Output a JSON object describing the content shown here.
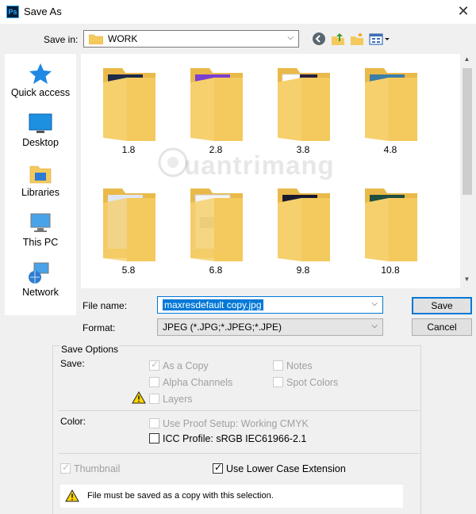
{
  "window": {
    "title": "Save As",
    "app_icon": "Ps",
    "close": "✕"
  },
  "savein": {
    "label": "Save in:",
    "value": "WORK"
  },
  "places": [
    {
      "label": "Quick access",
      "icon": "star-icon"
    },
    {
      "label": "Desktop",
      "icon": "desktop-icon"
    },
    {
      "label": "Libraries",
      "icon": "libraries-icon"
    },
    {
      "label": "This PC",
      "icon": "computer-icon"
    },
    {
      "label": "Network",
      "icon": "network-icon"
    }
  ],
  "files": [
    {
      "name": "1.8"
    },
    {
      "name": "2.8"
    },
    {
      "name": "3.8"
    },
    {
      "name": "4.8"
    },
    {
      "name": "5.8"
    },
    {
      "name": "6.8"
    },
    {
      "name": "9.8"
    },
    {
      "name": "10.8"
    }
  ],
  "watermark": "uantrimang",
  "filename": {
    "label": "File name:",
    "value": "maxresdefault copy.jpg"
  },
  "format": {
    "label": "Format:",
    "value": "JPEG (*.JPG;*.JPEG;*.JPE)"
  },
  "buttons": {
    "save": "Save",
    "cancel": "Cancel"
  },
  "options": {
    "legend": "Save Options",
    "save_label": "Save:",
    "as_a_copy": "As a Copy",
    "alpha_channels": "Alpha Channels",
    "layers": "Layers",
    "notes": "Notes",
    "spot_colors": "Spot Colors",
    "color_label": "Color:",
    "use_proof_setup": "Use Proof Setup:  Working CMYK",
    "icc_profile": "ICC Profile:  sRGB IEC61966-2.1",
    "thumbnail": "Thumbnail",
    "lower_case_ext": "Use Lower Case Extension",
    "warning": "File must be saved as a copy with this selection."
  },
  "colors": {
    "accent": "#0078d7",
    "folder": "#f4c95d"
  }
}
